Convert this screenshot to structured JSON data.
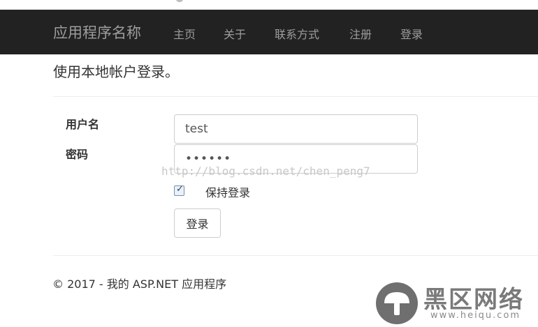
{
  "navbar": {
    "brand": "应用程序名称",
    "items": [
      "主页",
      "关于",
      "联系方式",
      "注册",
      "登录"
    ]
  },
  "page": {
    "heading": "使用本地帐户登录。"
  },
  "form": {
    "username_label": "用户名",
    "username_value": "test",
    "password_label": "密码",
    "password_value": "••••••",
    "remember_label": "保持登录",
    "remember_checked": true,
    "submit_label": "登录"
  },
  "watermark": "http://blog.csdn.net/chen_peng7",
  "footer": {
    "text": "© 2017 - 我的 ASP.NET 应用程序"
  },
  "logo": {
    "name": "黑区网络",
    "url": "www.heiqu.com"
  },
  "colors": {
    "navbar_bg": "#222222",
    "nav_text": "#9d9d9d",
    "logo_gray": "#6f6f6f"
  }
}
